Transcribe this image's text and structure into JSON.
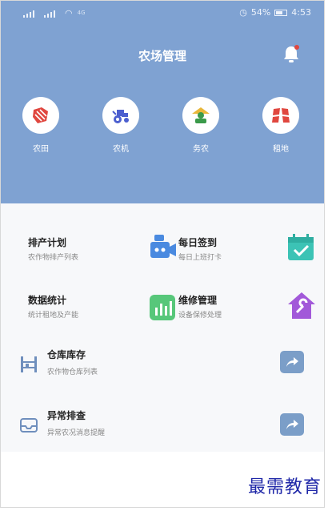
{
  "status_bar": {
    "network_label": "4G",
    "battery_percent": "54%",
    "time": "4:53"
  },
  "header": {
    "title": "农场管理",
    "notification_badge": true
  },
  "quick_actions": [
    {
      "label": "农田",
      "icon": "farmland-icon"
    },
    {
      "label": "农机",
      "icon": "tractor-icon"
    },
    {
      "label": "务农",
      "icon": "farmer-icon"
    },
    {
      "label": "租地",
      "icon": "land-lease-icon"
    }
  ],
  "grid_cards": [
    {
      "title": "排产计划",
      "subtitle": "农作物排产列表",
      "icon": "camera-plan-icon"
    },
    {
      "title": "每日签到",
      "subtitle": "每日上班打卡",
      "icon": "calendar-check-icon"
    },
    {
      "title": "数据统计",
      "subtitle": "统计租地及产能",
      "icon": "bar-chart-icon"
    },
    {
      "title": "维修管理",
      "subtitle": "设备保修处理",
      "icon": "house-wrench-icon"
    }
  ],
  "list_rows": [
    {
      "title": "仓库库存",
      "subtitle": "农作物仓库列表",
      "icon": "warehouse-icon"
    },
    {
      "title": "异常排查",
      "subtitle": "异常农况消息提醒",
      "icon": "inbox-alert-icon"
    }
  ],
  "watermark": "最需教育",
  "colors": {
    "header_bg": "#7fa2d2",
    "accent_red": "#e0473f",
    "button_blue": "#7b9ec8"
  }
}
